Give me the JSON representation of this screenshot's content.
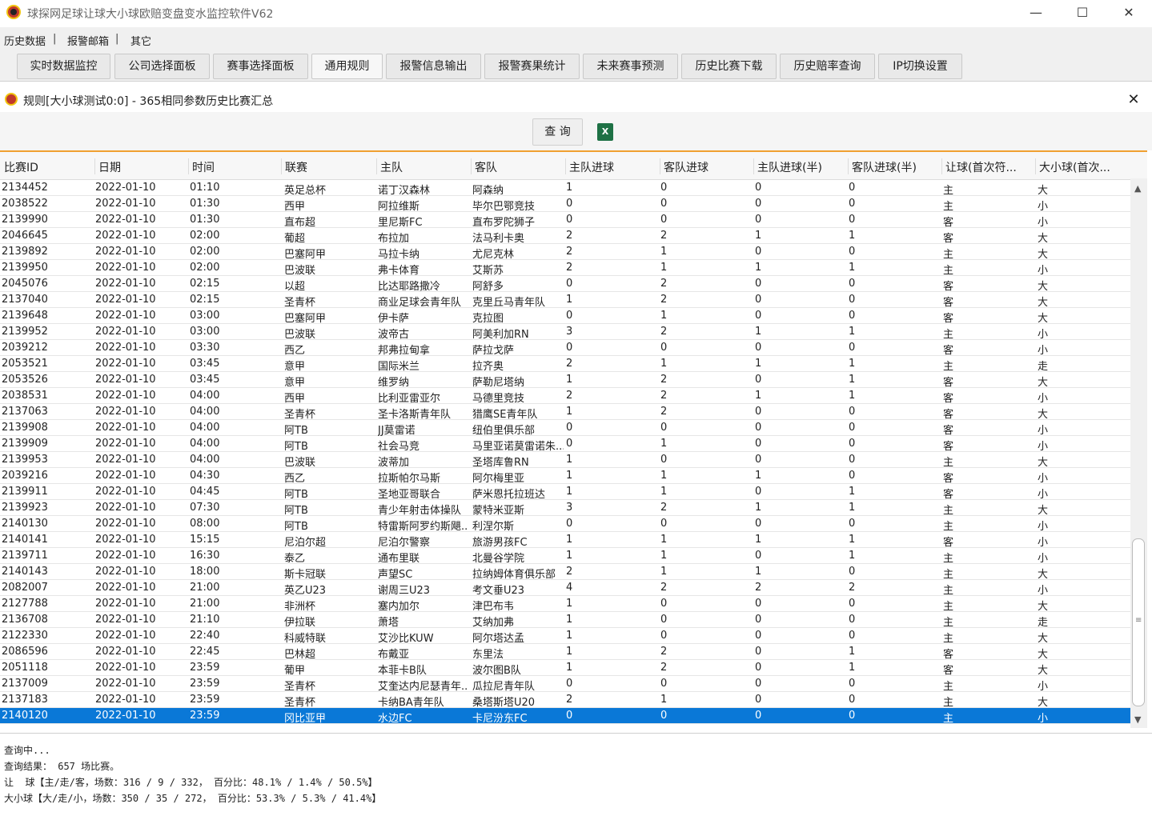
{
  "window": {
    "title": "球探网足球让球大小球欧赔变盘变水监控软件V62",
    "minimize": "—",
    "maximize": "☐",
    "close": "✕"
  },
  "menu": [
    "历史数据",
    "报警邮箱",
    "其它"
  ],
  "menu_sep": "|",
  "toolbar": [
    "实时数据监控",
    "公司选择面板",
    "赛事选择面板",
    "通用规则",
    "报警信息输出",
    "报警赛果统计",
    "未来赛事预测",
    "历史比赛下载",
    "历史赔率查询",
    "IP切换设置"
  ],
  "inner": {
    "title": "规则[大小球测试0:0] - 365相同参数历史比赛汇总",
    "close": "✕",
    "query_label": "查 询",
    "excel_icon": "X"
  },
  "columns": [
    "比赛ID",
    "日期",
    "时间",
    "联赛",
    "主队",
    "客队",
    "主队进球",
    "客队进球",
    "主队进球(半)",
    "客队进球(半)",
    "让球(首次符...",
    "大小球(首次..."
  ],
  "rows": [
    [
      "2134452",
      "2022-01-10",
      "01:10",
      "英足总杯",
      "诺丁汉森林",
      "阿森纳",
      "1",
      "0",
      "0",
      "0",
      "主",
      "大"
    ],
    [
      "2038522",
      "2022-01-10",
      "01:30",
      "西甲",
      "阿拉维斯",
      "毕尔巴鄂竞技",
      "0",
      "0",
      "0",
      "0",
      "主",
      "小"
    ],
    [
      "2139990",
      "2022-01-10",
      "01:30",
      "直布超",
      "里尼斯FC",
      "直布罗陀狮子",
      "0",
      "0",
      "0",
      "0",
      "客",
      "小"
    ],
    [
      "2046645",
      "2022-01-10",
      "02:00",
      "葡超",
      "布拉加",
      "法马利卡奥",
      "2",
      "2",
      "1",
      "1",
      "客",
      "大"
    ],
    [
      "2139892",
      "2022-01-10",
      "02:00",
      "巴塞阿甲",
      "马拉卡纳",
      "尤尼克林",
      "2",
      "1",
      "0",
      "0",
      "主",
      "大"
    ],
    [
      "2139950",
      "2022-01-10",
      "02:00",
      "巴波联",
      "弗卡体育",
      "艾斯苏",
      "2",
      "1",
      "1",
      "1",
      "主",
      "小"
    ],
    [
      "2045076",
      "2022-01-10",
      "02:15",
      "以超",
      "比达耶路撒冷",
      "阿舒多",
      "0",
      "2",
      "0",
      "0",
      "客",
      "大"
    ],
    [
      "2137040",
      "2022-01-10",
      "02:15",
      "圣青杯",
      "商业足球会青年队",
      "克里丘马青年队",
      "1",
      "2",
      "0",
      "0",
      "客",
      "大"
    ],
    [
      "2139648",
      "2022-01-10",
      "03:00",
      "巴塞阿甲",
      "伊卡萨",
      "克拉图",
      "0",
      "1",
      "0",
      "0",
      "客",
      "大"
    ],
    [
      "2139952",
      "2022-01-10",
      "03:00",
      "巴波联",
      "波帝古",
      "阿美利加RN",
      "3",
      "2",
      "1",
      "1",
      "主",
      "小"
    ],
    [
      "2039212",
      "2022-01-10",
      "03:30",
      "西乙",
      "邦弗拉甸拿",
      "萨拉戈萨",
      "0",
      "0",
      "0",
      "0",
      "客",
      "小"
    ],
    [
      "2053521",
      "2022-01-10",
      "03:45",
      "意甲",
      "国际米兰",
      "拉齐奥",
      "2",
      "1",
      "1",
      "1",
      "主",
      "走"
    ],
    [
      "2053526",
      "2022-01-10",
      "03:45",
      "意甲",
      "维罗纳",
      "萨勒尼塔纳",
      "1",
      "2",
      "0",
      "1",
      "客",
      "大"
    ],
    [
      "2038531",
      "2022-01-10",
      "04:00",
      "西甲",
      "比利亚雷亚尔",
      "马德里竞技",
      "2",
      "2",
      "1",
      "1",
      "客",
      "小"
    ],
    [
      "2137063",
      "2022-01-10",
      "04:00",
      "圣青杯",
      "圣卡洛斯青年队",
      "猎鹰SE青年队",
      "1",
      "2",
      "0",
      "0",
      "客",
      "大"
    ],
    [
      "2139908",
      "2022-01-10",
      "04:00",
      "阿TB",
      "JJ莫雷诺",
      "纽伯里俱乐部",
      "0",
      "0",
      "0",
      "0",
      "客",
      "小"
    ],
    [
      "2139909",
      "2022-01-10",
      "04:00",
      "阿TB",
      "社会马竞",
      "马里亚诺莫雷诺朱...",
      "0",
      "1",
      "0",
      "0",
      "客",
      "小"
    ],
    [
      "2139953",
      "2022-01-10",
      "04:00",
      "巴波联",
      "波蒂加",
      "圣塔库鲁RN",
      "1",
      "0",
      "0",
      "0",
      "主",
      "大"
    ],
    [
      "2039216",
      "2022-01-10",
      "04:30",
      "西乙",
      "拉斯帕尔马斯",
      "阿尔梅里亚",
      "1",
      "1",
      "1",
      "0",
      "客",
      "小"
    ],
    [
      "2139911",
      "2022-01-10",
      "04:45",
      "阿TB",
      "圣地亚哥联合",
      "萨米恩托拉班达",
      "1",
      "1",
      "0",
      "1",
      "客",
      "小"
    ],
    [
      "2139923",
      "2022-01-10",
      "07:30",
      "阿TB",
      "青少年射击体操队",
      "蒙特米亚斯",
      "3",
      "2",
      "1",
      "1",
      "主",
      "大"
    ],
    [
      "2140130",
      "2022-01-10",
      "08:00",
      "阿TB",
      "特雷斯阿罗约斯飓...",
      "利涅尔斯",
      "0",
      "0",
      "0",
      "0",
      "主",
      "小"
    ],
    [
      "2140141",
      "2022-01-10",
      "15:15",
      "尼泊尔超",
      "尼泊尔警察",
      "旅游男孩FC",
      "1",
      "1",
      "1",
      "1",
      "客",
      "小"
    ],
    [
      "2139711",
      "2022-01-10",
      "16:30",
      "泰乙",
      "通布里联",
      "北曼谷学院",
      "1",
      "1",
      "0",
      "1",
      "主",
      "小"
    ],
    [
      "2140143",
      "2022-01-10",
      "18:00",
      "斯卡冠联",
      "声望SC",
      "拉纳姆体育俱乐部",
      "2",
      "1",
      "1",
      "0",
      "主",
      "大"
    ],
    [
      "2082007",
      "2022-01-10",
      "21:00",
      "英乙U23",
      "谢周三U23",
      "考文垂U23",
      "4",
      "2",
      "2",
      "2",
      "主",
      "小"
    ],
    [
      "2127788",
      "2022-01-10",
      "21:00",
      "非洲杯",
      "塞内加尔",
      "津巴布韦",
      "1",
      "0",
      "0",
      "0",
      "主",
      "大"
    ],
    [
      "2136708",
      "2022-01-10",
      "21:10",
      "伊拉联",
      "萧塔",
      "艾纳加弗",
      "1",
      "0",
      "0",
      "0",
      "主",
      "走"
    ],
    [
      "2122330",
      "2022-01-10",
      "22:40",
      "科威特联",
      "艾沙比KUW",
      "阿尔塔达孟",
      "1",
      "0",
      "0",
      "0",
      "主",
      "大"
    ],
    [
      "2086596",
      "2022-01-10",
      "22:45",
      "巴林超",
      "布戴亚",
      "东里法",
      "1",
      "2",
      "0",
      "1",
      "客",
      "大"
    ],
    [
      "2051118",
      "2022-01-10",
      "23:59",
      "葡甲",
      "本菲卡B队",
      "波尔图B队",
      "1",
      "2",
      "0",
      "1",
      "客",
      "大"
    ],
    [
      "2137009",
      "2022-01-10",
      "23:59",
      "圣青杯",
      "艾奎达内尼瑟青年...",
      "瓜拉尼青年队",
      "0",
      "0",
      "0",
      "0",
      "主",
      "小"
    ],
    [
      "2137183",
      "2022-01-10",
      "23:59",
      "圣青杯",
      "卡纳BA青年队",
      "桑塔斯塔U20",
      "2",
      "1",
      "0",
      "0",
      "主",
      "大"
    ],
    [
      "2140120",
      "2022-01-10",
      "23:59",
      "冈比亚甲",
      "水边FC",
      "卡尼汾东FC",
      "0",
      "0",
      "0",
      "0",
      "主",
      "小"
    ]
  ],
  "selected_row": 33,
  "scrollbar": {
    "up": "▲",
    "down": "▼",
    "grip": "≡"
  },
  "log": [
    "查询中...",
    "查询结果： 657 场比赛。",
    "让  球【主/走/客，场数：316 / 9 / 332， 百分比：48.1% / 1.4% / 50.5%】",
    "大小球【大/走/小，场数：350 / 35 / 272， 百分比：53.3% / 5.3% / 41.4%】"
  ],
  "colors": {
    "accent": "#f0a030",
    "selected": "#0a78d7",
    "excel": "#1e7145"
  }
}
